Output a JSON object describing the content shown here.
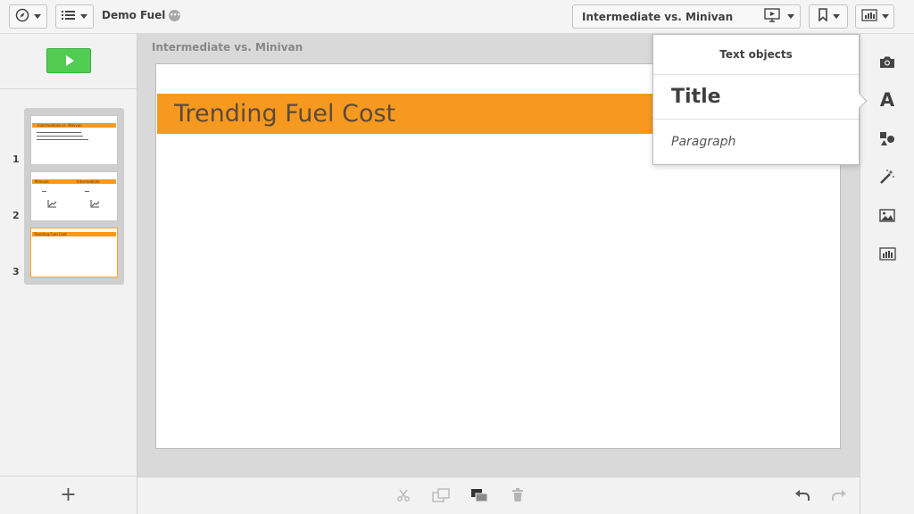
{
  "app": {
    "title": "Demo Fuel",
    "more_icon": "ellipsis-icon"
  },
  "toolbar": {
    "navigation_icon": "compass-icon",
    "menu_icon": "list-icon",
    "story_select": "Intermediate vs. Minivan",
    "present_icon": "presentation-play-icon",
    "bookmark_icon": "bookmark-icon",
    "snapshot_library_icon": "chart-library-icon"
  },
  "left_panel": {
    "play_icon": "play-icon",
    "add_icon": "plus-icon",
    "add_label": "+",
    "slides": [
      {
        "number": "1",
        "label": "Intermediate vs. Minivan"
      },
      {
        "number": "2",
        "left_label": "Minivan",
        "right_label": "Intermediate"
      },
      {
        "number": "3",
        "label": "Trending Fuel Cost"
      }
    ]
  },
  "canvas": {
    "sheet_title": "Intermediate vs. Minivan",
    "slide_title": "Trending Fuel Cost"
  },
  "popover": {
    "header": "Text objects",
    "items": [
      "Title",
      "Paragraph"
    ]
  },
  "right_rail": {
    "icons": [
      "camera-icon",
      "text-icon",
      "shapes-icon",
      "effects-wand-icon",
      "image-icon",
      "chart-library-icon"
    ],
    "text_glyph": "A"
  },
  "bottom_bar": {
    "icons": [
      "cut-icon",
      "copy-icon",
      "layer-order-icon",
      "delete-icon",
      "undo-icon",
      "redo-icon"
    ]
  },
  "colors": {
    "accent_orange": "#f7991e",
    "play_green": "#52cc52"
  }
}
